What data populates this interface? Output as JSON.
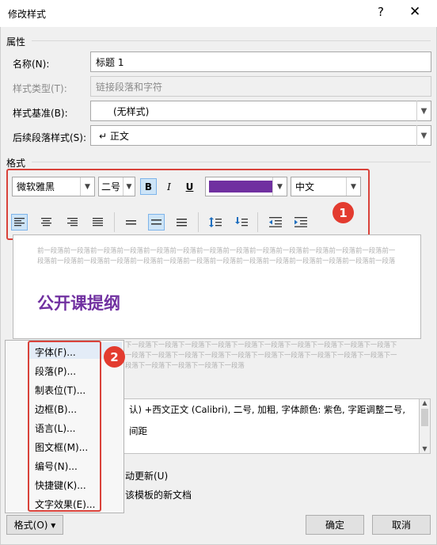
{
  "window": {
    "title": "修改样式",
    "help": "?",
    "close": "✕"
  },
  "properties": {
    "section_label": "属性",
    "name_label": "名称(N):",
    "name_value": "标题 1",
    "style_type_label": "样式类型(T):",
    "style_type_value": "链接段落和字符",
    "based_on_label": "样式基准(B):",
    "based_on_value": "(无样式)",
    "next_style_label": "后续段落样式(S):",
    "next_style_value": "↵ 正文"
  },
  "format": {
    "section_label": "格式",
    "font": "微软雅黑",
    "size": "二号",
    "bold": "B",
    "italic": "I",
    "underline": "U",
    "font_color": "#7030a0",
    "language": "中文",
    "badge1": "1",
    "badge2": "2"
  },
  "preview": {
    "before_text": "前一段落前一段落前一段落前一段落前一段落前一段落前一段落前一段落前一段落前一段落前一段落前一段落前一段落前一段落前一段落前一段落前一段落前一段落前一段落前一段落前一段落前一段落前一段落前一段落前一段落前一段落前一段落",
    "heading": "公开课提纲",
    "after_text": "下一段落下一段落下一段落下一段落下一段落下一段落下一段落下一段落下一段落下一段落下一段落下一段落下一段落下一段落下一段落下一段落下一段落下一段落下一段落下一段落下一段落下一段落下一段落下一段落下一段落"
  },
  "description": {
    "line1": "认) +西文正文 (Calibri), 二号, 加粗, 字体颜色: 紫色, 字距调整二号,",
    "line2": "间距"
  },
  "options": {
    "auto_update": "动更新(U)",
    "template": "该模板的新文档"
  },
  "menu": {
    "items": [
      "字体(F)...",
      "段落(P)...",
      "制表位(T)...",
      "边框(B)...",
      "语言(L)...",
      "图文框(M)...",
      "编号(N)...",
      "快捷键(K)...",
      "文字效果(E)..."
    ]
  },
  "buttons": {
    "format": "格式(O) ▾",
    "ok": "确定",
    "cancel": "取消"
  }
}
